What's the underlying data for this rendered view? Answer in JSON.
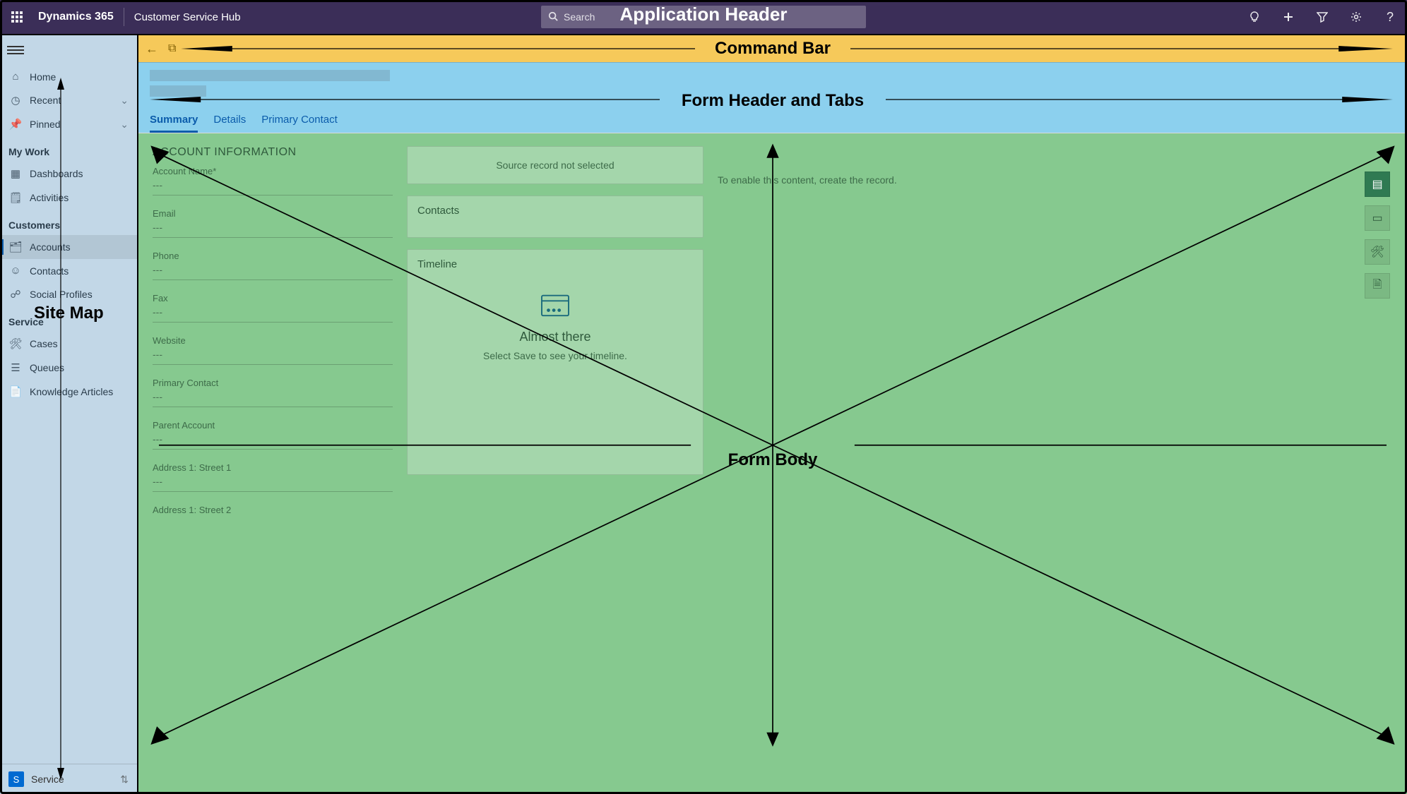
{
  "header": {
    "brand": "Dynamics 365",
    "app_name": "Customer Service Hub",
    "search_placeholder": "Search",
    "overlay_label": "Application Header"
  },
  "header_icons": {
    "waffle": "apps-icon",
    "lightbulb": "lightbulb-icon",
    "plus": "plus-icon",
    "filter": "filter-icon",
    "settings": "gear-icon",
    "help": "help-icon"
  },
  "sidebar": {
    "home": "Home",
    "recent": "Recent",
    "pinned": "Pinned",
    "group_mywork": "My Work",
    "dashboards": "Dashboards",
    "activities": "Activities",
    "group_customers": "Customers",
    "accounts": "Accounts",
    "contacts": "Contacts",
    "social": "Social Profiles",
    "group_service": "Service",
    "cases": "Cases",
    "queues": "Queues",
    "knowledge": "Knowledge Articles",
    "footer_letter": "S",
    "footer_label": "Service",
    "sitemap_label": "Site Map"
  },
  "cmdbar": {
    "label": "Command Bar"
  },
  "formhdr": {
    "label": "Form Header and Tabs",
    "tabs": {
      "summary": "Summary",
      "details": "Details",
      "primary": "Primary Contact"
    }
  },
  "formbody": {
    "label": "Form Body",
    "account_section": "ACCOUNT INFORMATION",
    "fields": {
      "account_name_label": "Account Name*",
      "email_label": "Email",
      "phone_label": "Phone",
      "fax_label": "Fax",
      "website_label": "Website",
      "primary_contact_label": "Primary Contact",
      "parent_account_label": "Parent Account",
      "addr1_label": "Address 1: Street 1",
      "addr2_label": "Address 1: Street 2",
      "empty_value": "---"
    },
    "mid": {
      "source_msg": "Source record not selected",
      "contacts_title": "Contacts",
      "timeline_title": "Timeline",
      "timeline_heading": "Almost there",
      "timeline_sub": "Select Save to see your timeline."
    },
    "right_msg": "To enable this content, create the record."
  }
}
